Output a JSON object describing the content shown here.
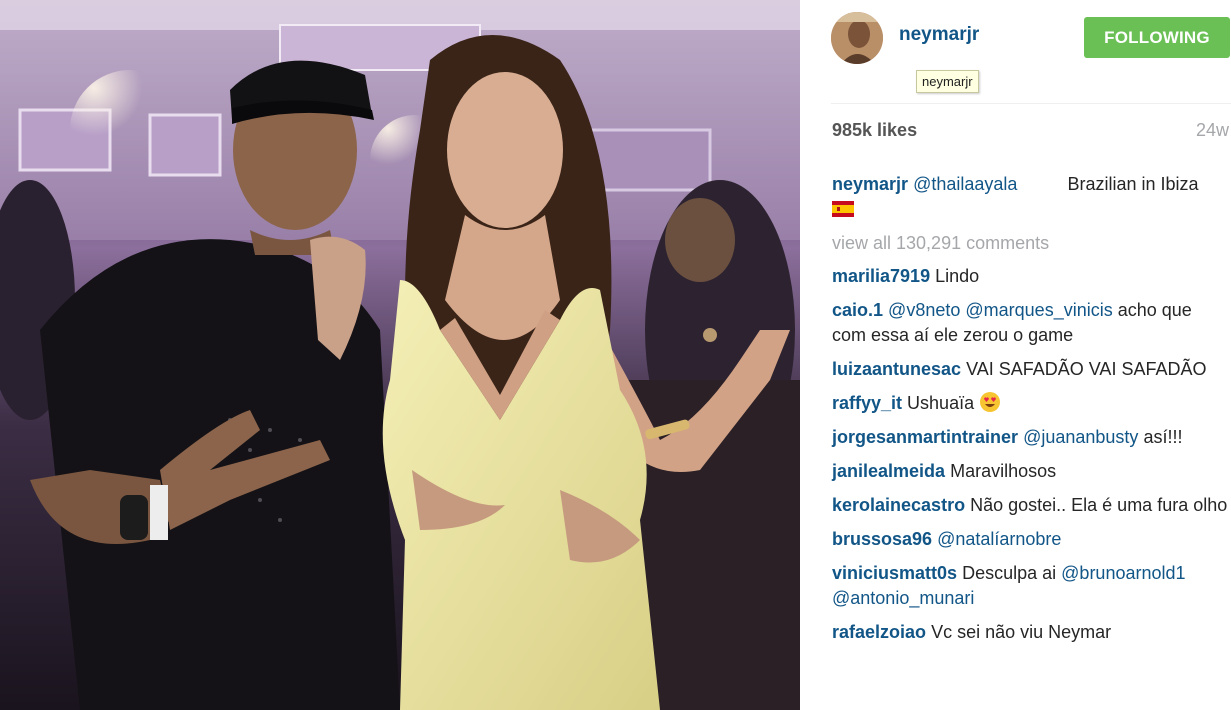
{
  "header": {
    "username": "neymarjr",
    "follow_label": "FOLLOWING",
    "tooltip": "neymarjr"
  },
  "stats": {
    "likes": "985k likes",
    "age": "24w"
  },
  "caption": {
    "user": "neymarjr",
    "mention": "@thailaayala",
    "text": "Brazilian in Ibiza",
    "flag_icon": "spain-flag-icon"
  },
  "view_all": "view all 130,291 comments",
  "comments": [
    {
      "user": "marilia7919",
      "mentions": [],
      "text": "Lindo"
    },
    {
      "user": "caio.1",
      "mentions": [
        "@v8neto",
        "@marques_vinicis"
      ],
      "text": "acho que com essa aí ele zerou o game"
    },
    {
      "user": "luizaantunesac",
      "mentions": [],
      "text": "VAI SAFADÃO VAI SAFADÃO"
    },
    {
      "user": "raffyy_it",
      "mentions": [],
      "text": "Ushuaïa",
      "emoji": "heart-eyes-emoji-icon"
    },
    {
      "user": "jorgesanmartintrainer",
      "mentions": [
        "@juananbusty"
      ],
      "text": "así!!!"
    },
    {
      "user": "janilealmeida",
      "mentions": [],
      "text": "Maravilhosos"
    },
    {
      "user": "kerolainecastro",
      "mentions": [],
      "text": "Não gostei.. Ela é uma fura olho"
    },
    {
      "user": "brussosa96",
      "mentions": [
        "@natalíarnobre"
      ],
      "text": ""
    },
    {
      "user": "viniciusmatt0s",
      "mentions": [],
      "text": "Desculpa ai",
      "trailing_mentions": [
        "@brunoarnold1",
        "@antonio_munari"
      ]
    },
    {
      "user": "rafaelzoiao",
      "mentions": [],
      "text": "Vc sei não viu Neymar"
    }
  ],
  "colors": {
    "link": "#125688",
    "follow_green": "#6bc055",
    "muted": "#a5a7aa"
  }
}
